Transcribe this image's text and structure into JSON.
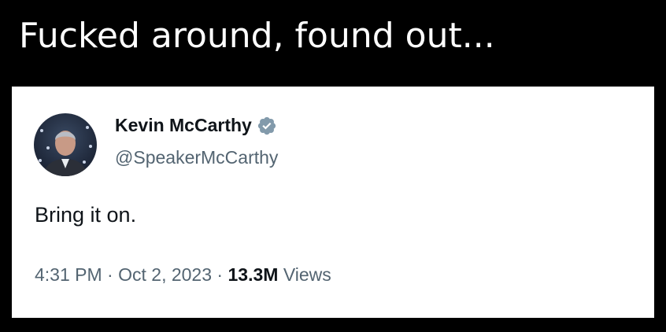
{
  "caption": "Fucked around, found out...",
  "tweet": {
    "display_name": "Kevin McCarthy",
    "handle": "@SpeakerMcCarthy",
    "verified_badge_icon": "verified-badge-icon",
    "verified_badge_color": "#829aab",
    "text": "Bring it on.",
    "time": "4:31 PM",
    "separator": "·",
    "date": "Oct 2, 2023",
    "views_count": "13.3M",
    "views_label": "Views"
  },
  "colors": {
    "page_background": "#000000",
    "caption_text": "#ffffff",
    "card_background": "#ffffff",
    "primary_text": "#0f1419",
    "secondary_text": "#536471"
  }
}
